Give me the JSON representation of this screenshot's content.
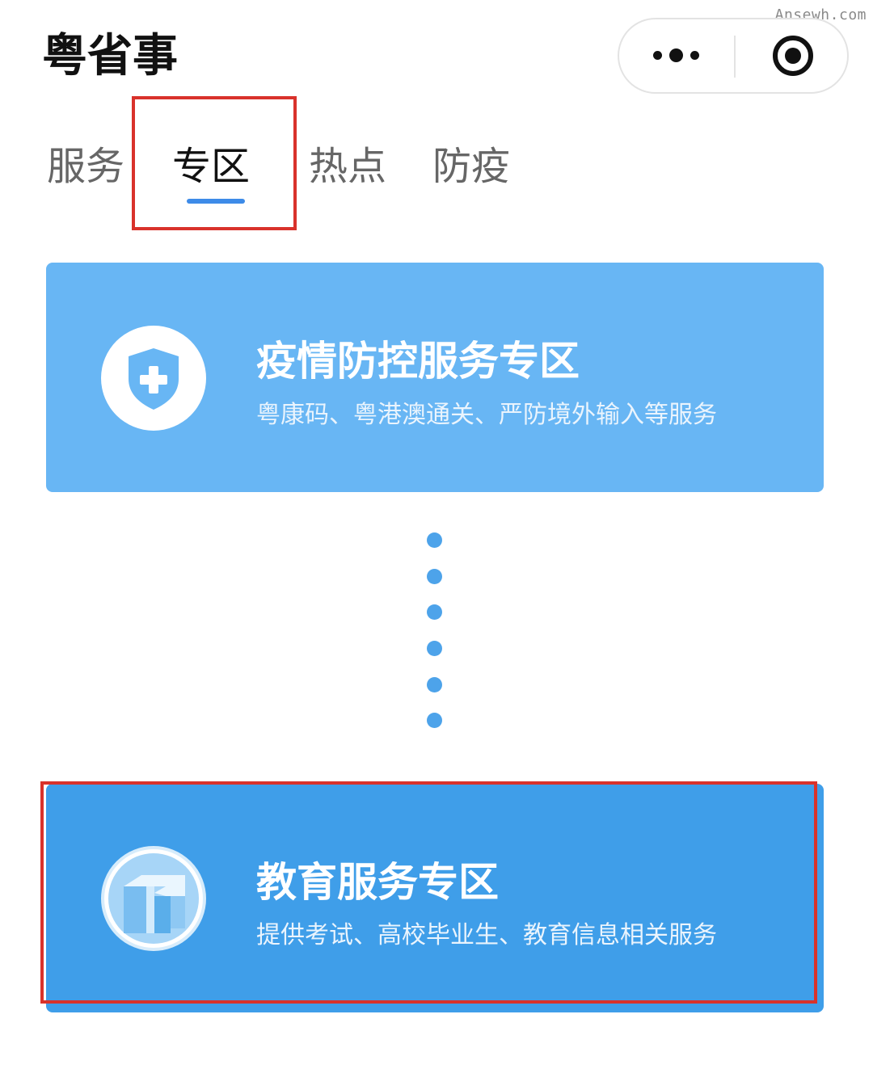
{
  "watermark": "Ansewh.com",
  "app": {
    "title": "粤省事"
  },
  "capsule": {
    "more_icon": "more-dots-icon",
    "close_icon": "target-close-icon"
  },
  "tabs": [
    {
      "label": "服务",
      "active": false
    },
    {
      "label": "专区",
      "active": true
    },
    {
      "label": "热点",
      "active": false
    },
    {
      "label": "防疫",
      "active": false
    }
  ],
  "cards": [
    {
      "title": "疫情防控服务专区",
      "subtitle": "粤康码、粤港澳通关、严防境外输入等服务",
      "icon": "shield-plus-icon",
      "color": "#68b6f4"
    },
    {
      "title": "教育服务专区",
      "subtitle": "提供考试、高校毕业生、教育信息相关服务",
      "icon": "education-building-icon",
      "color": "#3f9ee9"
    }
  ],
  "colors": {
    "accent": "#3d8be8",
    "highlight_box": "#d9322b",
    "connector": "#4da3ea"
  }
}
